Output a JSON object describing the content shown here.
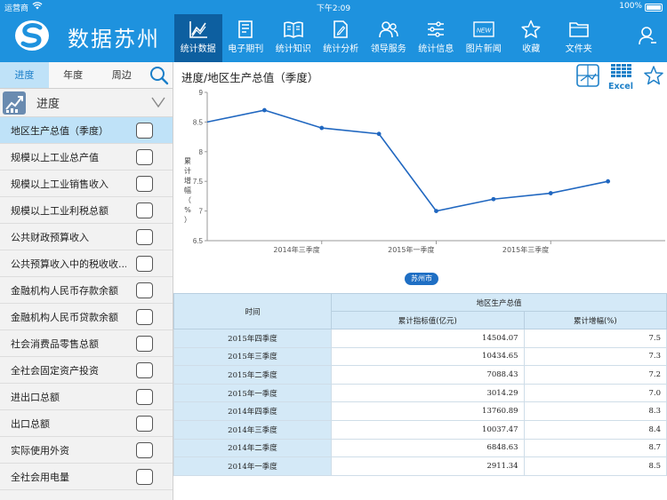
{
  "status_bar": {
    "carrier": "运营商",
    "time": "下午2:09",
    "battery": "100%"
  },
  "app": {
    "title": "数据苏州"
  },
  "nav": [
    {
      "label": "统计数据",
      "icon": "chart-icon",
      "active": true
    },
    {
      "label": "电子期刊",
      "icon": "book-icon",
      "active": false
    },
    {
      "label": "统计知识",
      "icon": "open-book-icon",
      "active": false
    },
    {
      "label": "统计分析",
      "icon": "edit-doc-icon",
      "active": false
    },
    {
      "label": "领导服务",
      "icon": "people-icon",
      "active": false
    },
    {
      "label": "统计信息",
      "icon": "sliders-icon",
      "active": false
    },
    {
      "label": "图片新闻",
      "icon": "new-badge-icon",
      "active": false
    },
    {
      "label": "收藏",
      "icon": "star-icon",
      "active": false
    },
    {
      "label": "文件夹",
      "icon": "folder-icon",
      "active": false
    }
  ],
  "nav_badge": "NEW",
  "sidebar": {
    "tabs": [
      {
        "label": "进度",
        "active": true
      },
      {
        "label": "年度",
        "active": false
      },
      {
        "label": "周边",
        "active": false
      }
    ],
    "section_label": "进度",
    "items": [
      {
        "label": "地区生产总值（季度）",
        "active": true
      },
      {
        "label": "规模以上工业总产值",
        "active": false
      },
      {
        "label": "规模以上工业销售收入",
        "active": false
      },
      {
        "label": "规模以上工业利税总额",
        "active": false
      },
      {
        "label": "公共财政预算收入",
        "active": false
      },
      {
        "label": "公共预算收入中的税收收...",
        "active": false
      },
      {
        "label": "金融机构人民币存款余额",
        "active": false
      },
      {
        "label": "金融机构人民币贷款余额",
        "active": false
      },
      {
        "label": "社会消费品零售总额",
        "active": false
      },
      {
        "label": "全社会固定资产投资",
        "active": false
      },
      {
        "label": "进出口总额",
        "active": false
      },
      {
        "label": "出口总额",
        "active": false
      },
      {
        "label": "实际使用外资",
        "active": false
      },
      {
        "label": "全社会用电量",
        "active": false
      }
    ]
  },
  "main": {
    "title": "进度/地区生产总值（季度）",
    "excel_label": "Excel",
    "region_label": "苏州市"
  },
  "chart_data": {
    "type": "line",
    "ylabel": "累计增幅（%）",
    "ylim": [
      6.5,
      9
    ],
    "yticks": [
      "9",
      "8.5",
      "8",
      "7.5",
      "7",
      "6.5"
    ],
    "x_tick_labels": [
      "2014年三季度",
      "2015年一季度",
      "2015年三季度"
    ],
    "x": [
      "2014年一季度",
      "2014年二季度",
      "2014年三季度",
      "2014年四季度",
      "2015年一季度",
      "2015年二季度",
      "2015年三季度",
      "2015年四季度"
    ],
    "series": [
      {
        "values": [
          8.5,
          8.7,
          8.4,
          8.3,
          7.0,
          7.2,
          7.3,
          7.5
        ]
      }
    ],
    "colors": {
      "line": "#2067c0",
      "axis": "#999999"
    }
  },
  "table": {
    "time_header": "时间",
    "group_header": "地区生产总值",
    "columns": [
      "累计指标值(亿元)",
      "累计增幅(%)"
    ],
    "rows": [
      {
        "time": "2015年四季度",
        "value": "14504.07",
        "growth": "7.5"
      },
      {
        "time": "2015年三季度",
        "value": "10434.65",
        "growth": "7.3"
      },
      {
        "time": "2015年二季度",
        "value": "7088.43",
        "growth": "7.2"
      },
      {
        "time": "2015年一季度",
        "value": "3014.29",
        "growth": "7.0"
      },
      {
        "time": "2014年四季度",
        "value": "13760.89",
        "growth": "8.3"
      },
      {
        "time": "2014年三季度",
        "value": "10037.47",
        "growth": "8.4"
      },
      {
        "time": "2014年二季度",
        "value": "6848.63",
        "growth": "8.7"
      },
      {
        "time": "2014年一季度",
        "value": "2911.34",
        "growth": "8.5"
      }
    ]
  }
}
